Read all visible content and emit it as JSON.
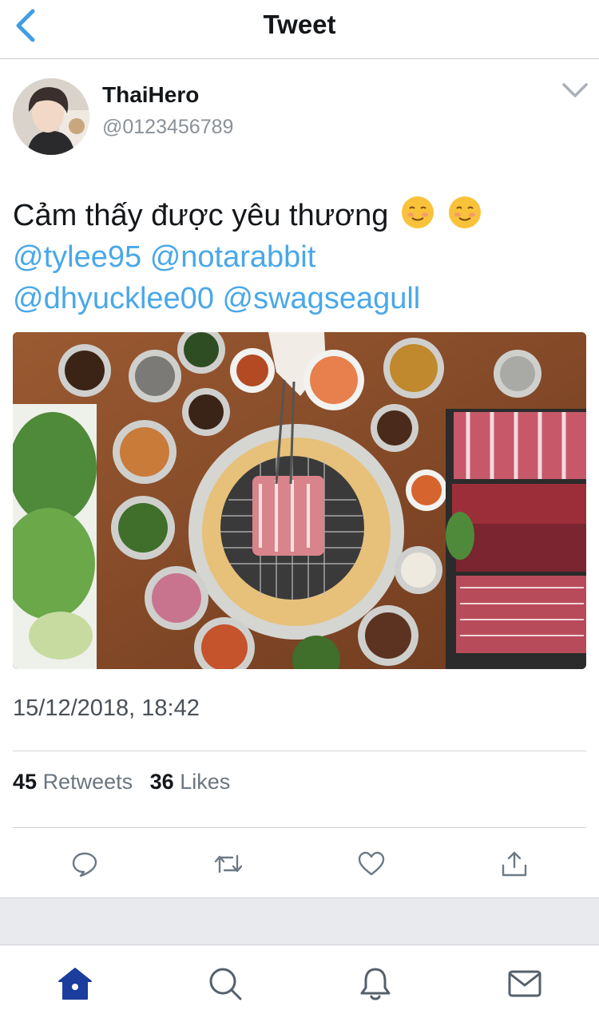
{
  "header": {
    "title": "Tweet",
    "back_icon": "chevron-left-icon"
  },
  "author": {
    "display_name": "ThaiHero",
    "handle": "@0123456789"
  },
  "tweet": {
    "text": "Cảm thấy được yêu thương",
    "emojis": [
      "☺️",
      "☺️"
    ],
    "mentions": [
      "@tylee95",
      "@notarabbit",
      "@dhyucklee00",
      "@swagseagull"
    ],
    "timestamp": "15/12/2018, 18:42"
  },
  "stats": {
    "retweets_count": "45",
    "retweets_label": "Retweets",
    "likes_count": "36",
    "likes_label": "Likes"
  },
  "actions": [
    "reply-icon",
    "retweet-icon",
    "like-icon",
    "share-icon"
  ],
  "tabs": [
    "home-icon",
    "search-icon",
    "notifications-icon",
    "messages-icon"
  ],
  "colors": {
    "accent": "#1d9bf0",
    "mention": "#4aa8e8",
    "home_active": "#1a3d9e"
  }
}
